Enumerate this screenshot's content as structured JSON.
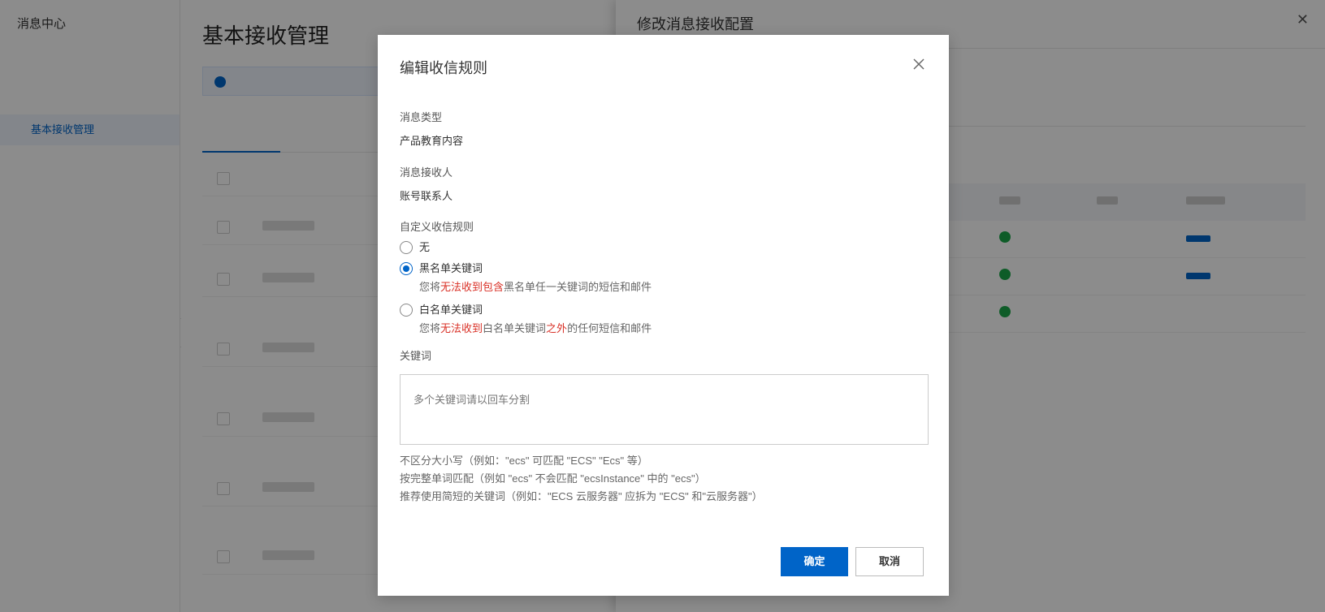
{
  "sidebar": {
    "brand": "消息中心",
    "active_item": "基本接收管理"
  },
  "main": {
    "page_title": "基本接收管理"
  },
  "drawer": {
    "title": "修改消息接收配置",
    "close_glyph": "✕"
  },
  "modal": {
    "title": "编辑收信规则",
    "message_type_label": "消息类型",
    "message_type_value": "产品教育内容",
    "recipient_label": "消息接收人",
    "recipient_value": "账号联系人",
    "rule_label": "自定义收信规则",
    "options": {
      "none": {
        "label": "无",
        "checked": false
      },
      "blacklist": {
        "label": "黑名单关键词",
        "checked": true,
        "desc_pre": "您将",
        "desc_hl1": "无法收到包含",
        "desc_post": "黑名单任一关键词的短信和邮件"
      },
      "whitelist": {
        "label": "白名单关键词",
        "checked": false,
        "desc_pre": "您将",
        "desc_hl1": "无法收到",
        "desc_mid": "白名单关键词",
        "desc_hl2": "之外",
        "desc_post": "的任何短信和邮件"
      }
    },
    "keyword_label": "关键词",
    "keyword_placeholder": "多个关键词请以回车分割",
    "keyword_value": "",
    "hints": [
      "不区分大小写（例如：\"ecs\" 可匹配 \"ECS\" \"Ecs\" 等）",
      "按完整单词匹配（例如 \"ecs\" 不会匹配 \"ecsInstance\" 中的 \"ecs\"）",
      "推荐使用简短的关键词（例如：\"ECS 云服务器\" 应拆为 \"ECS\" 和\"云服务器\"）"
    ],
    "confirm_label": "确定",
    "cancel_label": "取消"
  },
  "colors": {
    "primary": "#0064c8",
    "highlight": "#d93026",
    "mask": "rgba(0,0,0,0.45)"
  }
}
